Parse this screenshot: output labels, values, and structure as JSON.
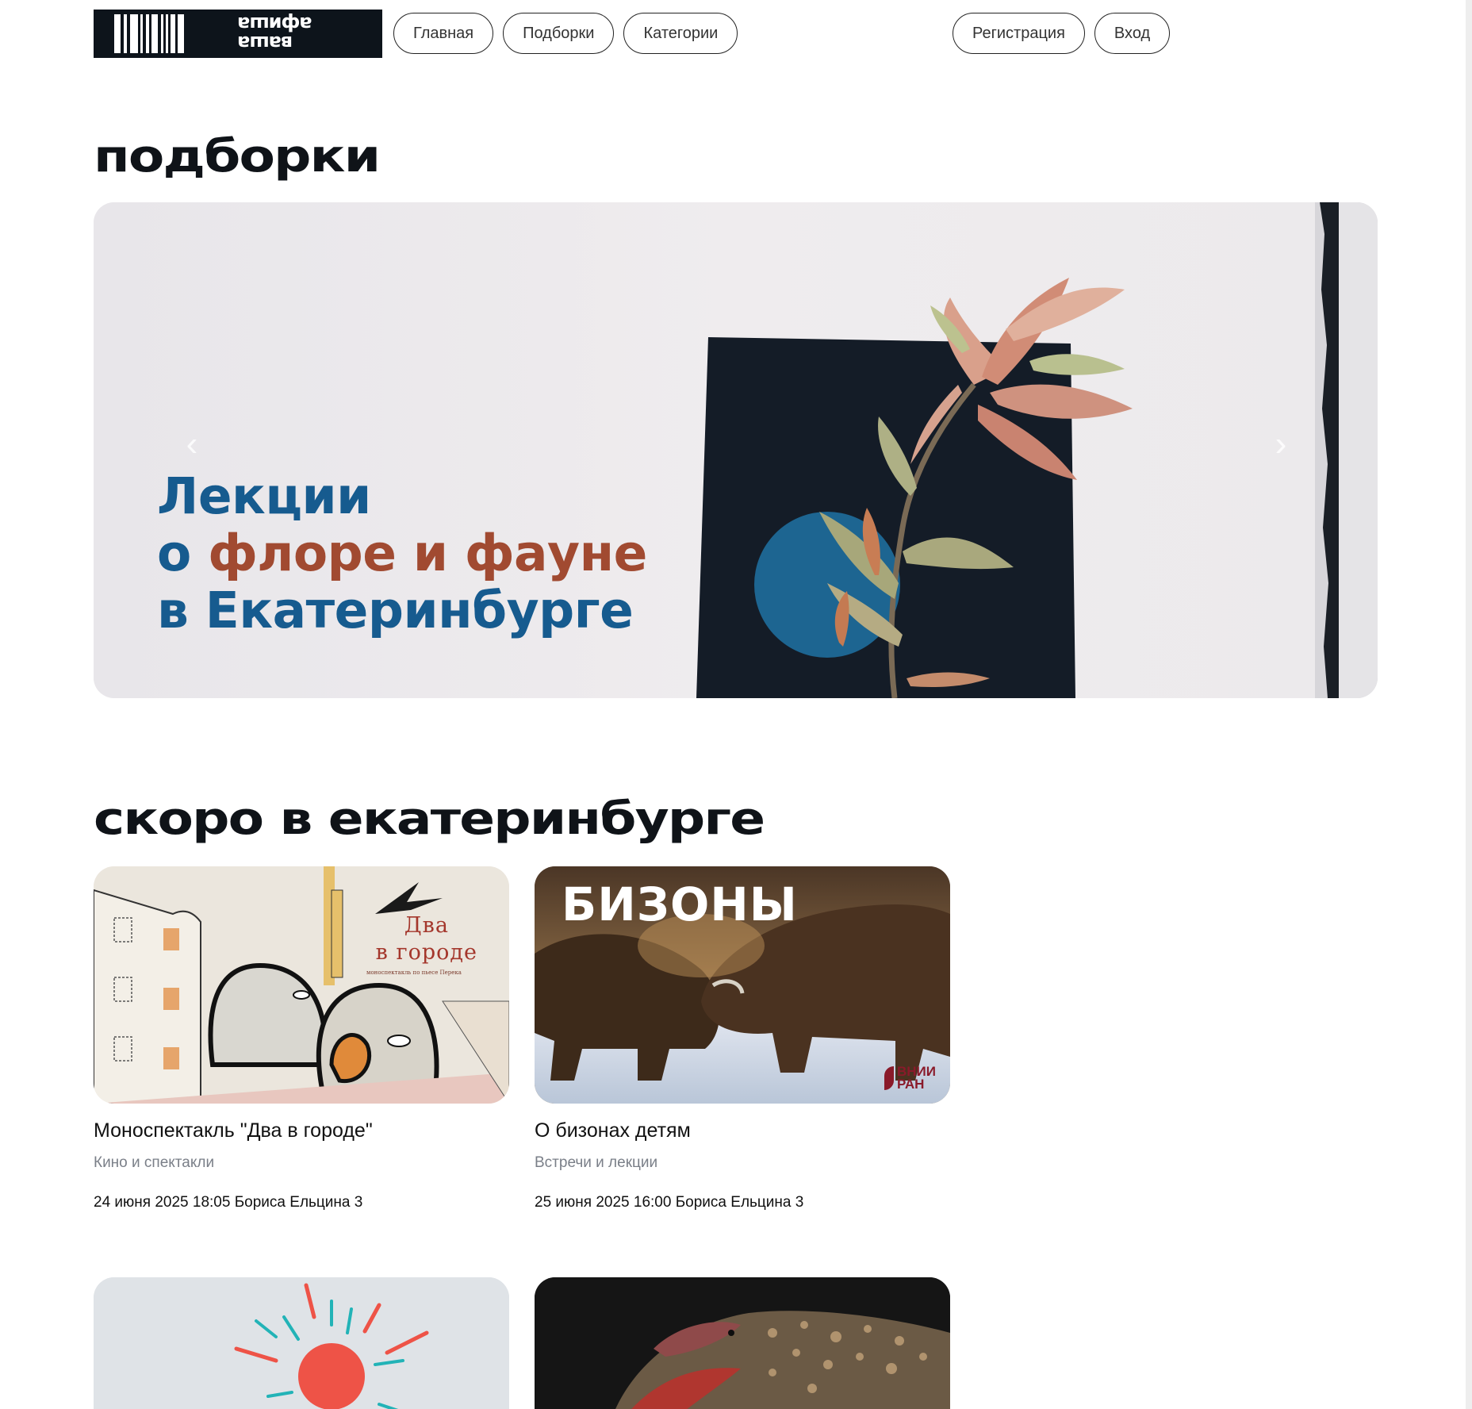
{
  "header": {
    "logo_top": "ваша",
    "logo_bottom": "афиша",
    "nav": [
      "Главная",
      "Подборки",
      "Категории"
    ],
    "auth": [
      "Регистрация",
      "Вход"
    ]
  },
  "sections": {
    "collections_title": "подборки",
    "upcoming_title": "скоро в екатеринбурге"
  },
  "banner": {
    "line1": "Лекции",
    "line2_prefix": "о ",
    "line2_accent": "флоре и фауне",
    "line3": "в Екатеринбурге",
    "prev_arrow": "‹",
    "next_arrow": "›",
    "prev_icon": "chevron-left-icon",
    "next_icon": "chevron-right-icon"
  },
  "events": [
    {
      "title": "Моноспектакль \"Два в городе\"",
      "category": "Кино и спектакли",
      "meta": "24 июня 2025 18:05 Бориса Ельцина 3",
      "image_title": "Два\nв городе",
      "image_subtitle": "моноспектакль по пьесе Перека"
    },
    {
      "title": "О бизонах детям",
      "category": "Встречи и лекции",
      "meta": "25 июня 2025 16:00 Бориса Ельцина 3",
      "image_title": "БИЗОНЫ",
      "image_logo": "ВНИИ\nРАН"
    }
  ],
  "colors": {
    "banner_blue": "#165b8f",
    "banner_accent": "#a14a31",
    "muted_text": "#7a7f88",
    "logo_bg": "#0d141b"
  }
}
